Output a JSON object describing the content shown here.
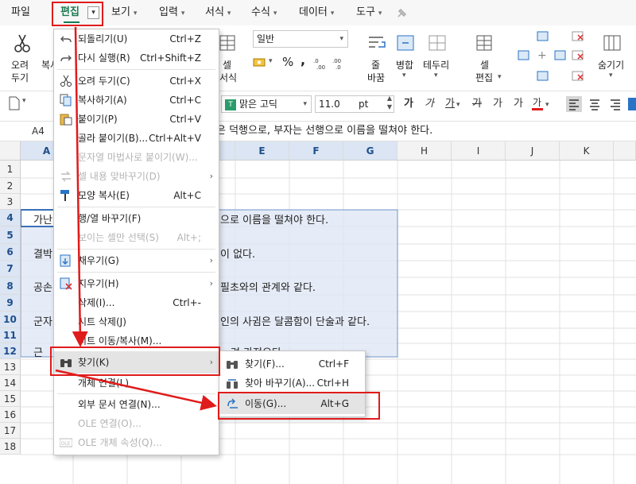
{
  "menubar": {
    "items": [
      {
        "label": "파일"
      },
      {
        "label": "편집"
      },
      {
        "label": "보기"
      },
      {
        "label": "입력"
      },
      {
        "label": "서식"
      },
      {
        "label": "수식"
      },
      {
        "label": "데이터"
      },
      {
        "label": "도구"
      }
    ]
  },
  "ribbon": {
    "cut_label_1": "오려",
    "cut_label_2": "두기",
    "copy_label_partial": "복사",
    "cellstyle_label_1": "셀",
    "cellstyle_label_2": "서식",
    "number_format": "일반",
    "percent": "%",
    "comma": ",",
    "wrap_label_1": "줄",
    "wrap_label_2": "바꿈",
    "merge_label": "병합",
    "border_label": "테두리",
    "celledit_label_1": "셀",
    "celledit_label_2": "편집",
    "hide_label": "숨기기"
  },
  "formatbar": {
    "font_name": "맑은 고딕",
    "font_size": "11.0",
    "size_unit": "pt",
    "char_buttons": [
      "가",
      "가",
      "가",
      "가",
      "가",
      "가"
    ]
  },
  "formula_bar": {
    "cell_ref": "A4",
    "content_partial": "은 덕행으로, 부자는 선행으로 이름을 떨쳐야 한다."
  },
  "grid": {
    "columns": [
      "A",
      "B",
      "C",
      "D",
      "E",
      "F",
      "G",
      "H",
      "I",
      "J",
      "K"
    ],
    "rows": [
      "1",
      "2",
      "3",
      "4",
      "5",
      "6",
      "7",
      "8",
      "9",
      "10",
      "11",
      "12",
      "13",
      "14",
      "15",
      "16",
      "17",
      "18"
    ],
    "cells": {
      "a4": "가난",
      "r4": "으로 이름을 떨쳐야 한다.",
      "a6": "결박",
      "r6": "이 없다.",
      "a8": "공손",
      "r8": "필초와의 관계와 같다.",
      "a10": "군자",
      "r10": "인의 사귐은 달콤함이 단술과 같다.",
      "a12": "근",
      "r12": "려 가져오다"
    }
  },
  "edit_menu": {
    "items": [
      {
        "label": "되돌리기(U)",
        "shortcut": "Ctrl+Z"
      },
      {
        "label": "다시 실행(R)",
        "shortcut": "Ctrl+Shift+Z"
      },
      {
        "label": "오려 두기(C)",
        "shortcut": "Ctrl+X"
      },
      {
        "label": "복사하기(A)",
        "shortcut": "Ctrl+C"
      },
      {
        "label": "붙이기(P)",
        "shortcut": "Ctrl+V"
      },
      {
        "label": "골라 붙이기(B)...",
        "shortcut": "Ctrl+Alt+V"
      },
      {
        "label": "문자열 마법사로 붙이기(W)...",
        "shortcut": ""
      },
      {
        "label": "셀 내용 맞바꾸기(D)",
        "shortcut": ""
      },
      {
        "label": "모양 복사(E)",
        "shortcut": "Alt+C"
      },
      {
        "label": "행/열 바꾸기(F)",
        "shortcut": ""
      },
      {
        "label": "보이는 셀만 선택(S)",
        "shortcut": "Alt+;"
      },
      {
        "label": "채우기(G)",
        "shortcut": ""
      },
      {
        "label": "지우기(H)",
        "shortcut": ""
      },
      {
        "label": "삭제(I)...",
        "shortcut": "Ctrl+-"
      },
      {
        "label": "시트 삭제(J)",
        "shortcut": ""
      },
      {
        "label": "시트 이동/복사(M)...",
        "shortcut": ""
      },
      {
        "label": "찾기(K)",
        "shortcut": ""
      },
      {
        "label": "개체 연결(L)",
        "shortcut": ""
      },
      {
        "label": "외부 문서 연결(N)...",
        "shortcut": ""
      },
      {
        "label": "OLE 연결(O)...",
        "shortcut": ""
      },
      {
        "label": "OLE 개체 속성(Q)...",
        "shortcut": ""
      }
    ]
  },
  "find_submenu": {
    "items": [
      {
        "label": "찾기(F)...",
        "shortcut": "Ctrl+F"
      },
      {
        "label": "찾아 바꾸기(A)...",
        "shortcut": "Ctrl+H"
      },
      {
        "label": "이동(G)...",
        "shortcut": "Alt+G"
      }
    ]
  },
  "colors": {
    "annotation_red": "#e01b1b",
    "accent_green": "#1b7a52",
    "selection_fill": "#dbe5f3"
  }
}
